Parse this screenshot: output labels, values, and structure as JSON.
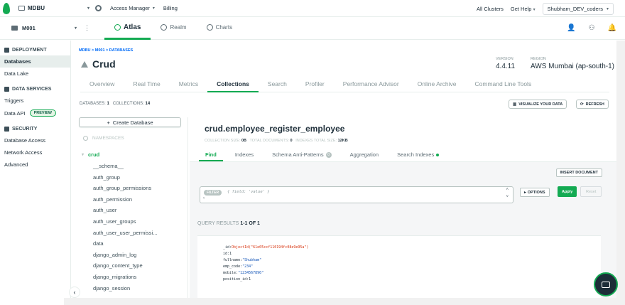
{
  "topbar": {
    "org_name": "MDBU",
    "access_manager": "Access Manager",
    "billing": "Billing",
    "all_clusters": "All Clusters",
    "get_help": "Get Help",
    "user": "Shubham_DEV_coders"
  },
  "secondbar": {
    "project": "M001",
    "tabs": [
      {
        "label": "Atlas"
      },
      {
        "label": "Realm"
      },
      {
        "label": "Charts"
      }
    ]
  },
  "sidebar": {
    "deployment": "DEPLOYMENT",
    "databases": "Databases",
    "data_lake": "Data Lake",
    "data_services": "DATA SERVICES",
    "triggers": "Triggers",
    "data_api": "Data API",
    "preview": "PREVIEW",
    "security": "SECURITY",
    "database_access": "Database Access",
    "network_access": "Network Access",
    "advanced": "Advanced"
  },
  "main": {
    "breadcrumb": "MDBU > M001 > DATABASES",
    "title": "Crud",
    "version_label": "VERSION",
    "version": "4.4.11",
    "region_label": "REGION",
    "region": "AWS Mumbai (ap-south-1)",
    "tabs": [
      "Overview",
      "Real Time",
      "Metrics",
      "Collections",
      "Search",
      "Profiler",
      "Performance Advisor",
      "Online Archive",
      "Command Line Tools"
    ],
    "databases_label": "DATABASES:",
    "databases_count": "1",
    "collections_label": "COLLECTIONS:",
    "collections_count": "14",
    "visualize": "VISUALIZE YOUR DATA",
    "refresh": "REFRESH"
  },
  "dbpanel": {
    "create": "Create Database",
    "namespaces_placeholder": "NAMESPACES",
    "db": "crud",
    "collections": [
      "__schema__",
      "auth_group",
      "auth_group_permissions",
      "auth_permission",
      "auth_user",
      "auth_user_groups",
      "auth_user_user_permissi...",
      "data",
      "django_admin_log",
      "django_content_type",
      "django_migrations",
      "django_session"
    ]
  },
  "collection": {
    "name": "crud.employee_register_employee",
    "size_label": "COLLECTION SIZE:",
    "size": "0B",
    "total_docs_label": "TOTAL DOCUMENTS:",
    "total_docs": "0",
    "index_size_label": "INDEXES TOTAL SIZE:",
    "index_size": "12KB",
    "tabs": [
      "Find",
      "Indexes",
      "Schema Anti-Patterns",
      "Aggregation",
      "Search Indexes"
    ],
    "anti_pattern_count": "0",
    "insert": "INSERT DOCUMENT",
    "filter_pill": "FILTER",
    "filter_placeholder": "{ field: 'value' }",
    "options": "OPTIONS",
    "apply": "Apply",
    "reset": "Reset",
    "query_results_label": "QUERY RESULTS",
    "query_results_count": "1-1 OF 1",
    "doc": {
      "id_key": "_id:",
      "id_val": "ObjectId(\"61e05ccf110194fc08e9e95a\")",
      "f1_key": "id:",
      "f1_val": "1",
      "f2_key": "fullname:",
      "f2_val": "\"Shubham\"",
      "f3_key": "emp_code:",
      "f3_val": "\"234\"",
      "f4_key": "mobile:",
      "f4_val": "\"1234567890\"",
      "f5_key": "position_id:",
      "f5_val": "1"
    }
  },
  "colors": {
    "accent": "#13aa52",
    "link": "#016bf8"
  }
}
